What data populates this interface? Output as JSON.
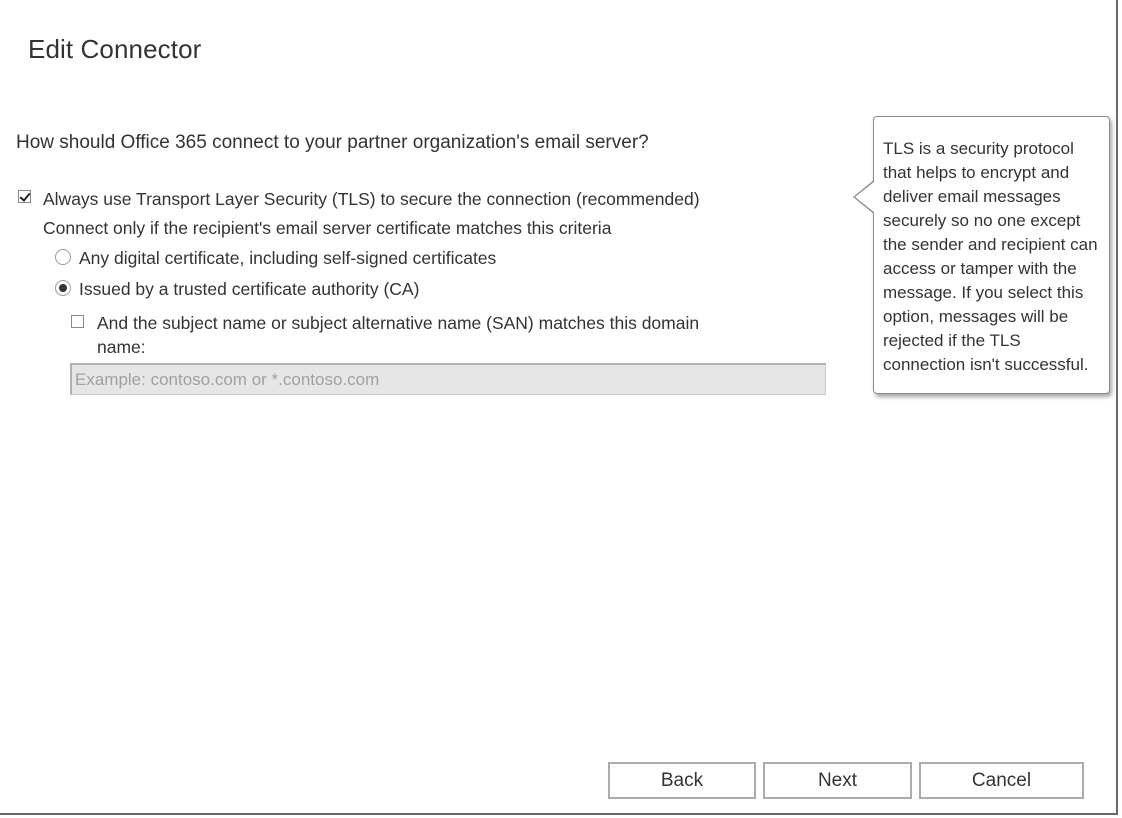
{
  "dialog": {
    "title": "Edit Connector",
    "question": "How should Office 365 connect to your partner organization's email server?"
  },
  "tls": {
    "checkbox_label": "Always use Transport Layer Security (TLS) to secure the connection (recommended)",
    "checked": true,
    "criteria_text": "Connect only if the recipient's email server certificate matches this criteria"
  },
  "certificate_options": [
    {
      "label": "Any digital certificate, including self-signed certificates",
      "selected": false
    },
    {
      "label": "Issued by a trusted certificate authority (CA)",
      "selected": true
    }
  ],
  "san": {
    "checkbox_label_line1": "And the subject name or subject alternative name (SAN) matches this domain",
    "checkbox_label_line2": "name:",
    "checked": false,
    "domain_placeholder": "Example: contoso.com or *.contoso.com",
    "domain_value": ""
  },
  "callout": {
    "text": "TLS is a security protocol that helps to encrypt and deliver email messages securely so no one except the sender and recipient can access or tamper with the message. If you select this option, messages will be rejected if the TLS connection isn't successful."
  },
  "buttons": {
    "back": "Back",
    "next": "Next",
    "cancel": "Cancel"
  }
}
